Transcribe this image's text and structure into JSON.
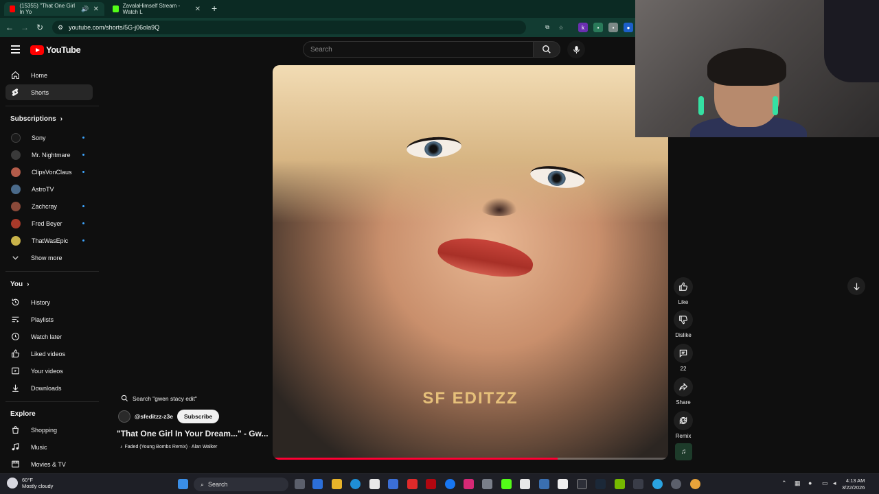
{
  "browser": {
    "tabs": [
      {
        "title": "(15355) \"That One Girl In Yo",
        "favicon_color": "#ff0000",
        "active": true
      },
      {
        "title": "ZavalaHimself Stream - Watch L",
        "favicon_color": "#53fc18",
        "active": false
      }
    ],
    "url": "youtube.com/shorts/5G-j06ola9Q"
  },
  "masthead": {
    "logo_text": "YouTube",
    "search_placeholder": "Search"
  },
  "sidebar": {
    "main": [
      {
        "label": "Home",
        "icon": "home-icon"
      },
      {
        "label": "Shorts",
        "icon": "shorts-icon",
        "active": true
      }
    ],
    "subscriptions_heading": "Subscriptions",
    "subscriptions": [
      {
        "label": "Sony",
        "color": "#1a1a1a",
        "new": true
      },
      {
        "label": "Mr. Nightmare",
        "color": "#3a3a3a",
        "new": true
      },
      {
        "label": "ClipsVonClaus",
        "color": "#b45c4a",
        "new": true
      },
      {
        "label": "AstroTV",
        "color": "#4a6a8a",
        "new": false
      },
      {
        "label": "Zachcray",
        "color": "#8a4a3a",
        "new": true
      },
      {
        "label": "Fred Beyer",
        "color": "#a83a2a",
        "new": true
      },
      {
        "label": "ThatWasEpic",
        "color": "#c9b34a",
        "new": true
      }
    ],
    "show_more": "Show more",
    "you_heading": "You",
    "you_items": [
      {
        "label": "History",
        "icon": "history-icon"
      },
      {
        "label": "Playlists",
        "icon": "playlists-icon"
      },
      {
        "label": "Watch later",
        "icon": "clock-icon"
      },
      {
        "label": "Liked videos",
        "icon": "thumbs-up-icon"
      },
      {
        "label": "Your videos",
        "icon": "video-icon"
      },
      {
        "label": "Downloads",
        "icon": "download-icon"
      }
    ],
    "explore_heading": "Explore",
    "explore_items": [
      {
        "label": "Shopping",
        "icon": "shopping-icon"
      },
      {
        "label": "Music",
        "icon": "music-icon"
      },
      {
        "label": "Movies & TV",
        "icon": "film-icon"
      }
    ]
  },
  "short": {
    "search_suggestion": "Search \"gwen stacy edit\"",
    "channel": "@sfeditzz-z3e",
    "subscribe_label": "Subscribe",
    "title": "\"That One Girl In Your Dream...\" - Gw...",
    "music": "Faded (Young Bombs Remix) · Alan Walker",
    "watermark": "SF EDITZZ",
    "progress": 0.72
  },
  "actions": {
    "like": "Like",
    "dislike": "Dislike",
    "comments": "22",
    "share": "Share",
    "remix": "Remix"
  },
  "taskbar": {
    "temperature": "60°F",
    "weather": "Mostly cloudy",
    "search": "Search",
    "time": "4:13 AM",
    "date": "3/22/2026"
  }
}
